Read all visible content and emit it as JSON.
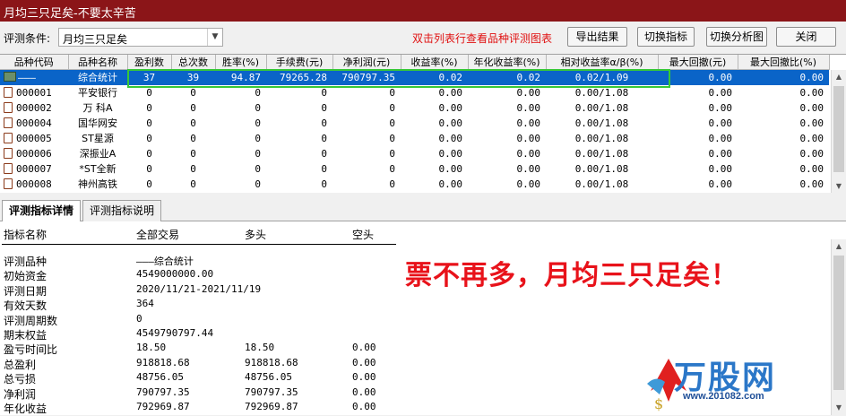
{
  "window": {
    "title": "月均三只足矣-不要太辛苦"
  },
  "toolbar": {
    "condition_label": "评测条件:",
    "condition_value": "月均三只足矣",
    "hint": "双击列表行查看品种评测图表",
    "export_label": "导出结果",
    "switch_indicator_label": "切换指标",
    "switch_chart_label": "切换分析图",
    "close_label": "关闭"
  },
  "grid": {
    "columns": [
      "品种代码",
      "品种名称",
      "盈利数",
      "总次数",
      "胜率(%)",
      "手续费(元)",
      "净利润(元)",
      "收益率(%)",
      "年化收益率(%)",
      "相对收益率α/β(%)",
      "最大回撤(元)",
      "最大回撤比(%)"
    ],
    "rows": [
      {
        "code": "———",
        "name": "综合统计",
        "win": "37",
        "total": "39",
        "rate": "94.87",
        "fee": "79265.28",
        "profit": "790797.35",
        "ret": "0.02",
        "annual": "0.02",
        "relative": "0.02/1.09",
        "dd": "0.00",
        "ddr": "0.00",
        "selected": true
      },
      {
        "code": "000001",
        "name": "平安银行",
        "win": "0",
        "total": "0",
        "rate": "0",
        "fee": "0",
        "profit": "0",
        "ret": "0.00",
        "annual": "0.00",
        "relative": "0.00/1.08",
        "dd": "0.00",
        "ddr": "0.00"
      },
      {
        "code": "000002",
        "name": "万 科A",
        "win": "0",
        "total": "0",
        "rate": "0",
        "fee": "0",
        "profit": "0",
        "ret": "0.00",
        "annual": "0.00",
        "relative": "0.00/1.08",
        "dd": "0.00",
        "ddr": "0.00"
      },
      {
        "code": "000004",
        "name": "国华网安",
        "win": "0",
        "total": "0",
        "rate": "0",
        "fee": "0",
        "profit": "0",
        "ret": "0.00",
        "annual": "0.00",
        "relative": "0.00/1.08",
        "dd": "0.00",
        "ddr": "0.00"
      },
      {
        "code": "000005",
        "name": "ST星源",
        "win": "0",
        "total": "0",
        "rate": "0",
        "fee": "0",
        "profit": "0",
        "ret": "0.00",
        "annual": "0.00",
        "relative": "0.00/1.08",
        "dd": "0.00",
        "ddr": "0.00"
      },
      {
        "code": "000006",
        "name": "深振业A",
        "win": "0",
        "total": "0",
        "rate": "0",
        "fee": "0",
        "profit": "0",
        "ret": "0.00",
        "annual": "0.00",
        "relative": "0.00/1.08",
        "dd": "0.00",
        "ddr": "0.00"
      },
      {
        "code": "000007",
        "name": "*ST全新",
        "win": "0",
        "total": "0",
        "rate": "0",
        "fee": "0",
        "profit": "0",
        "ret": "0.00",
        "annual": "0.00",
        "relative": "0.00/1.08",
        "dd": "0.00",
        "ddr": "0.00"
      },
      {
        "code": "000008",
        "name": "神州高铁",
        "win": "0",
        "total": "0",
        "rate": "0",
        "fee": "0",
        "profit": "0",
        "ret": "0.00",
        "annual": "0.00",
        "relative": "0.00/1.08",
        "dd": "0.00",
        "ddr": "0.00"
      }
    ]
  },
  "tabs": [
    {
      "label": "评测指标详情",
      "active": true
    },
    {
      "label": "评测指标说明",
      "active": false
    }
  ],
  "detail": {
    "headers": {
      "name": "指标名称",
      "all": "全部交易",
      "long": "多头",
      "short": "空头"
    },
    "rows": [
      {
        "name": "评测品种",
        "all": "———综合统计",
        "long": "",
        "short": ""
      },
      {
        "name": "初始资金",
        "all": "4549000000.00",
        "long": "",
        "short": ""
      },
      {
        "name": "评测日期",
        "all": "2020/11/21-2021/11/19",
        "long": "",
        "short": ""
      },
      {
        "name": "有效天数",
        "all": "364",
        "long": "",
        "short": ""
      },
      {
        "name": "评测周期数",
        "all": "0",
        "long": "",
        "short": ""
      },
      {
        "name": "期末权益",
        "all": "4549790797.44",
        "long": "",
        "short": ""
      },
      {
        "name": "盈亏时间比",
        "all": "18.50",
        "long": "18.50",
        "short": "0.00"
      },
      {
        "name": "总盈利",
        "all": "918818.68",
        "long": "918818.68",
        "short": "0.00"
      },
      {
        "name": "总亏损",
        "all": "48756.05",
        "long": "48756.05",
        "short": "0.00"
      },
      {
        "name": "净利润",
        "all": "790797.35",
        "long": "790797.35",
        "short": "0.00"
      },
      {
        "name": "年化收益",
        "all": "792969.87",
        "long": "792969.87",
        "short": "0.00"
      }
    ],
    "slogan": "票不再多，月均三只足矣！"
  },
  "watermark": {
    "brand": "万股网",
    "url": "www.201082.com"
  },
  "colors": {
    "title_bar": "#8b1518",
    "selection": "#0a64c8",
    "highlight_box": "#37c837",
    "slogan": "#e8121a",
    "hint": "#e01010"
  }
}
